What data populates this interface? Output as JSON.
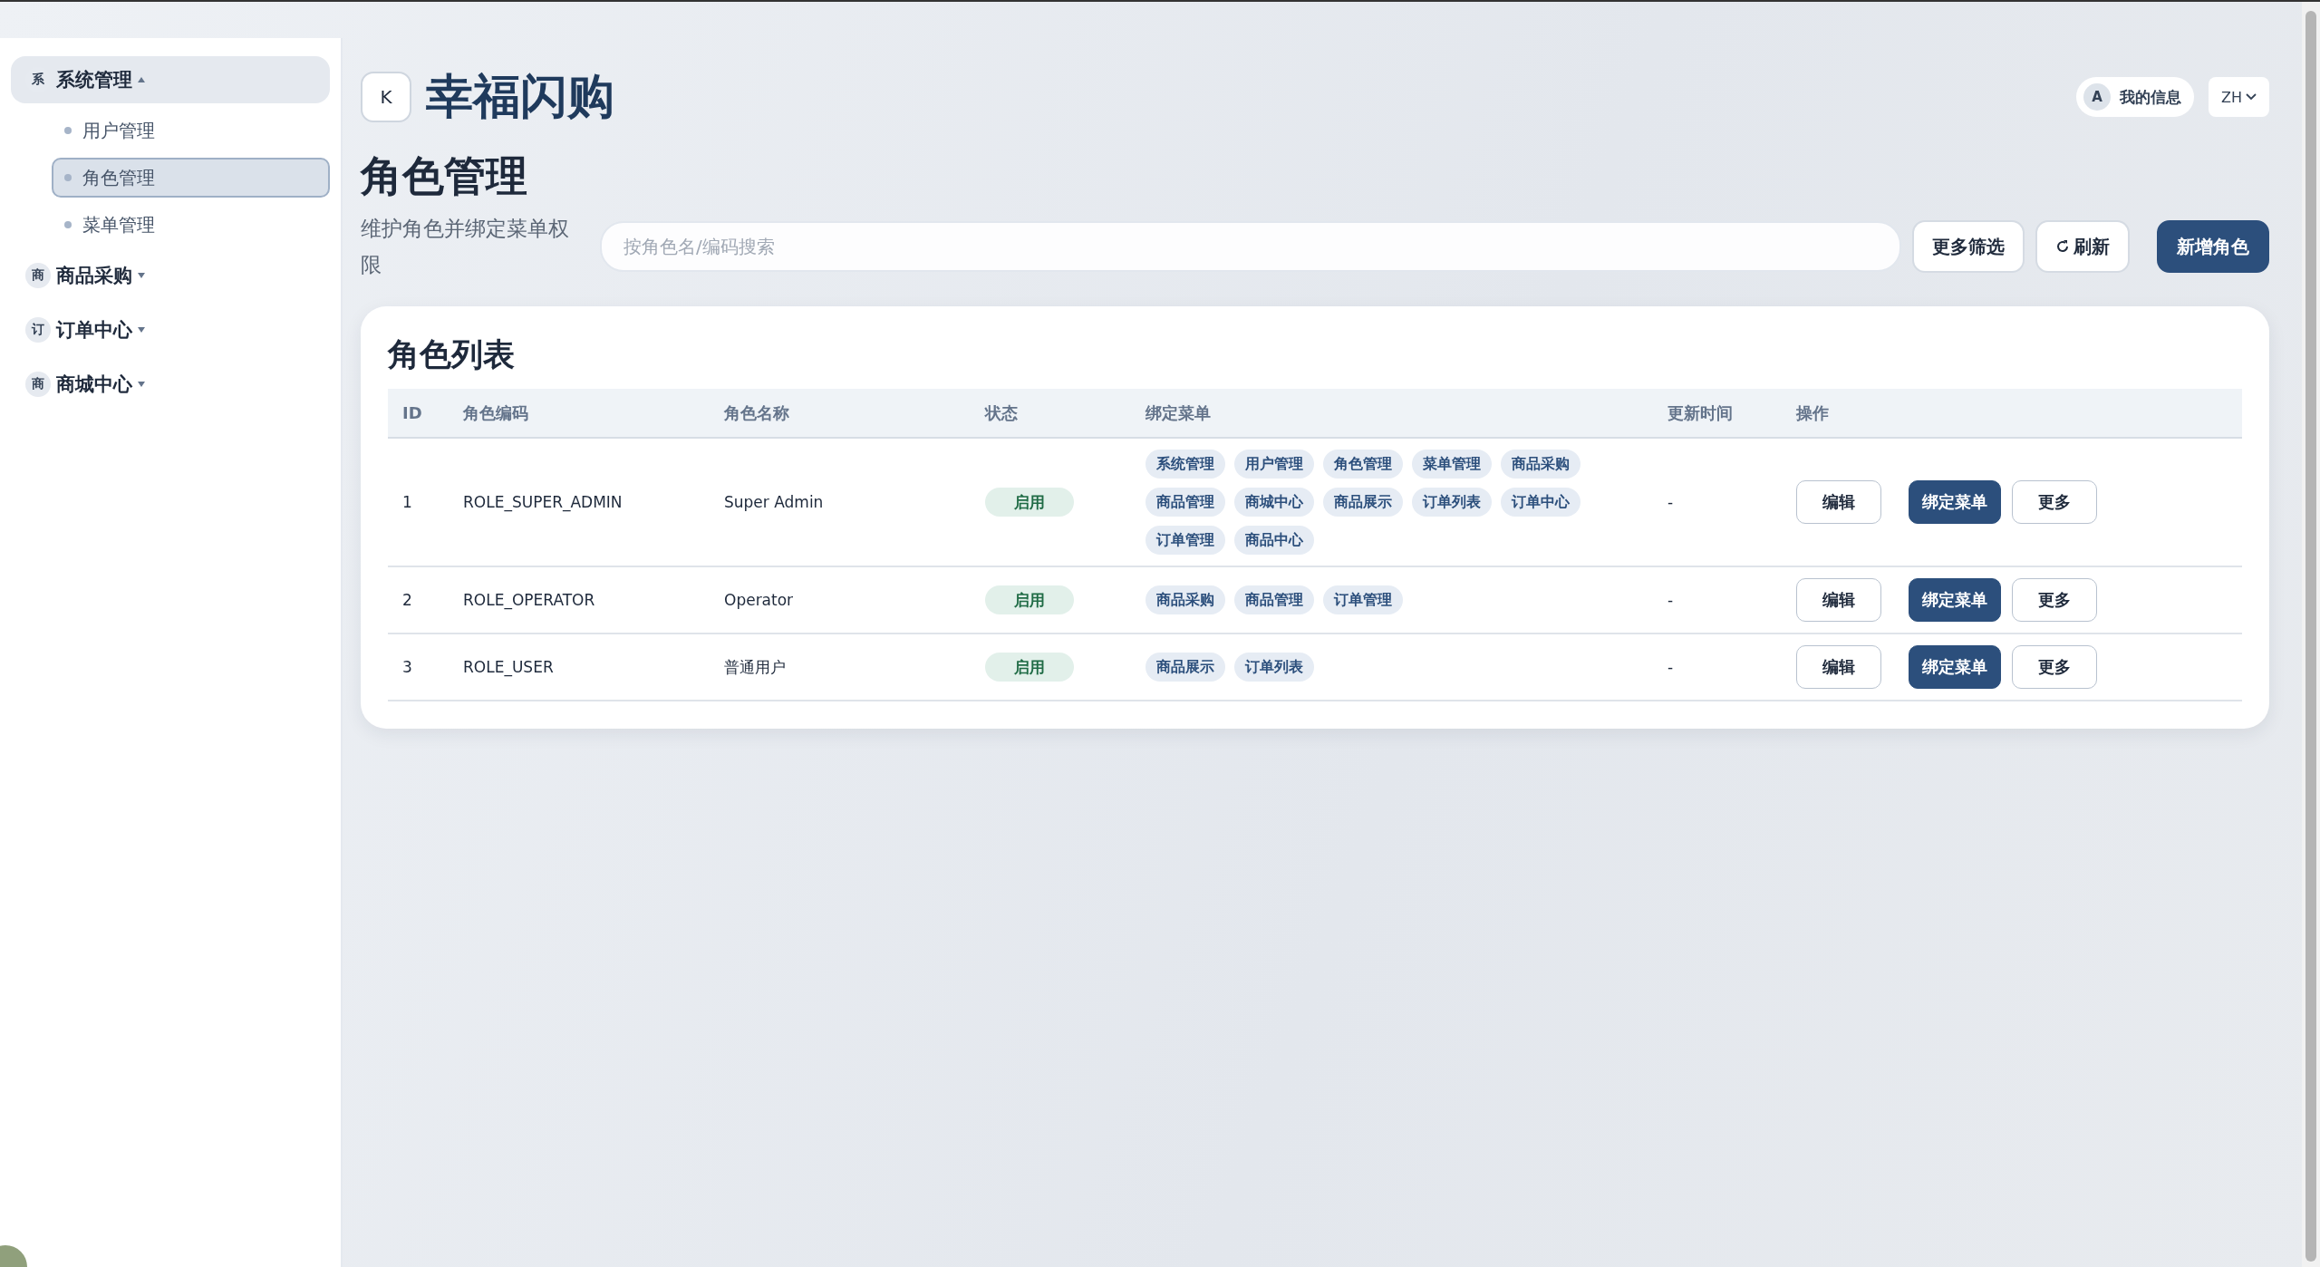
{
  "sidebar": {
    "groups": [
      {
        "badge": "系",
        "label": "系统管理",
        "expanded": true,
        "children": [
          {
            "label": "用户管理",
            "selected": false
          },
          {
            "label": "角色管理",
            "selected": true
          },
          {
            "label": "菜单管理",
            "selected": false
          }
        ]
      },
      {
        "badge": "商",
        "label": "商品采购",
        "expanded": false
      },
      {
        "badge": "订",
        "label": "订单中心",
        "expanded": false
      },
      {
        "badge": "商",
        "label": "商城中心",
        "expanded": false
      }
    ]
  },
  "header": {
    "logo": "K",
    "app_title": "幸福闪购",
    "user": {
      "avatar": "A",
      "label": "我的信息"
    },
    "language": "ZH"
  },
  "page": {
    "title": "角色管理",
    "subtitle": "维护角色并绑定菜单权限",
    "search": {
      "placeholder": "按角色名/编码搜索"
    },
    "filter_button": "更多筛选",
    "refresh_button": "刷新",
    "add_button": "新增角色"
  },
  "card": {
    "title": "角色列表",
    "columns": [
      "ID",
      "角色编码",
      "角色名称",
      "状态",
      "绑定菜单",
      "更新时间",
      "操作"
    ],
    "rows": [
      {
        "id": "1",
        "code": "ROLE_SUPER_ADMIN",
        "name": "Super Admin",
        "status": "启用",
        "menus": [
          "系统管理",
          "用户管理",
          "角色管理",
          "菜单管理",
          "商品采购",
          "商品管理",
          "商城中心",
          "商品展示",
          "订单列表",
          "订单中心",
          "订单管理",
          "商品中心"
        ],
        "updated": "-",
        "actions": [
          "编辑",
          "绑定菜单",
          "更多"
        ]
      },
      {
        "id": "2",
        "code": "ROLE_OPERATOR",
        "name": "Operator",
        "status": "启用",
        "menus": [
          "商品采购",
          "商品管理",
          "订单管理"
        ],
        "updated": "-",
        "actions": [
          "编辑",
          "绑定菜单",
          "更多"
        ]
      },
      {
        "id": "3",
        "code": "ROLE_USER",
        "name": "普通用户",
        "status": "启用",
        "menus": [
          "商品展示",
          "订单列表"
        ],
        "updated": "-",
        "actions": [
          "编辑",
          "绑定菜单",
          "更多"
        ]
      }
    ]
  }
}
